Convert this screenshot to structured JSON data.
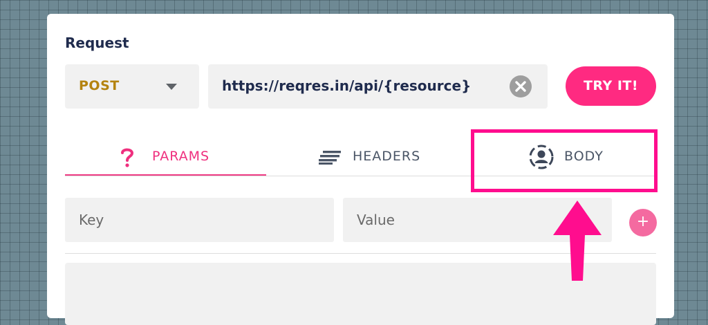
{
  "request": {
    "title": "Request",
    "method": "POST",
    "url": "https://reqres.in/api/{resource}",
    "try_label": "TRY IT!"
  },
  "tabs": [
    {
      "label": "PARAMS",
      "icon": "question-mark-icon",
      "active": true
    },
    {
      "label": "HEADERS",
      "icon": "lines-icon",
      "active": false
    },
    {
      "label": "BODY",
      "icon": "user-frame-icon",
      "active": false
    }
  ],
  "params": {
    "key_placeholder": "Key",
    "value_placeholder": "Value",
    "add_symbol": "+"
  },
  "colors": {
    "accent": "#ff2a81",
    "highlight": "#ff0d8e",
    "method": "#b4830f",
    "text_dark": "#1f2b4d"
  }
}
